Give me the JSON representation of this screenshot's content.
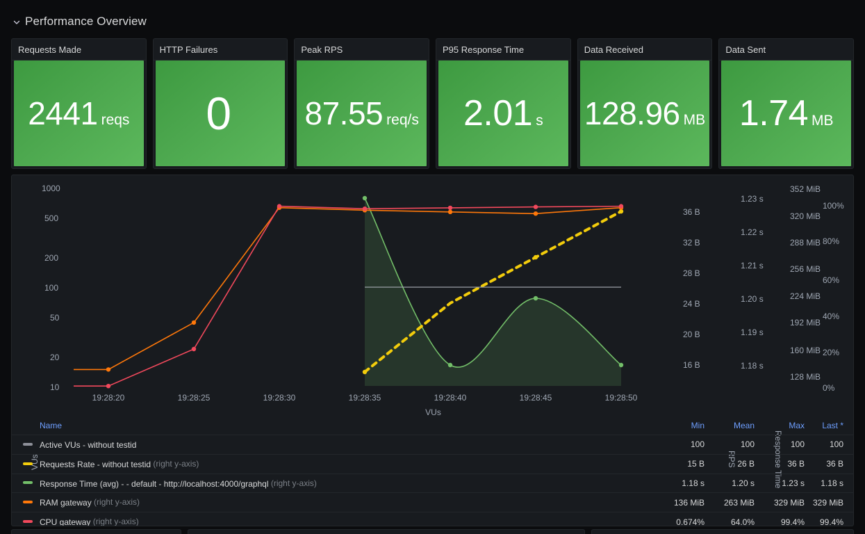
{
  "row": {
    "title": "Performance Overview",
    "collapse_icon": "chevron-down-icon",
    "expanded": true
  },
  "stats": [
    {
      "title": "Requests Made",
      "value": "2441",
      "unit": "reqs",
      "color": "#5cb85c",
      "size": "small"
    },
    {
      "title": "HTTP Failures",
      "value": "0",
      "unit": "",
      "color": "#5cb85c",
      "size": "big"
    },
    {
      "title": "Peak RPS",
      "value": "87.55",
      "unit": "req/s",
      "color": "#5cb85c",
      "size": "small"
    },
    {
      "title": "P95 Response Time",
      "value": "2.01",
      "unit": "s",
      "color": "#5cb85c",
      "size": "mid"
    },
    {
      "title": "Data Received",
      "value": "128.96",
      "unit": "MB",
      "color": "#5cb85c",
      "size": "small"
    },
    {
      "title": "Data Sent",
      "value": "1.74",
      "unit": "MB",
      "color": "#5cb85c",
      "size": "mid"
    }
  ],
  "chart_data": {
    "type": "line",
    "title": "",
    "xlabel": "VUs",
    "x_ticks": [
      "19:28:20",
      "19:28:25",
      "19:28:30",
      "19:28:35",
      "19:28:40",
      "19:28:45",
      "19:28:50"
    ],
    "grid": false,
    "legend_position": "bottom-table",
    "axes": [
      {
        "id": "left-vus",
        "side": "left",
        "title": "VUs",
        "scale": "log",
        "ticks": [
          "1000",
          "500",
          "200",
          "100",
          "50",
          "20",
          "10"
        ],
        "tick_values": [
          1000,
          500,
          200,
          100,
          50,
          20,
          10
        ]
      },
      {
        "id": "right-bytes",
        "side": "right",
        "title": "",
        "scale": "linear",
        "ticks": [
          "36 B",
          "32 B",
          "28 B",
          "24 B",
          "20 B",
          "16 B"
        ],
        "tick_values": [
          36,
          32,
          28,
          24,
          20,
          16
        ]
      },
      {
        "id": "right-rps",
        "side": "right",
        "title": "RPS",
        "scale": "linear",
        "ticks": [
          "1.23 s",
          "1.22 s",
          "1.21 s",
          "1.20 s",
          "1.19 s",
          "1.18 s"
        ],
        "tick_values": [
          1.23,
          1.22,
          1.21,
          1.2,
          1.19,
          1.18
        ]
      },
      {
        "id": "right-resptime",
        "side": "right",
        "title": "Response Time",
        "scale": "linear",
        "ticks": [
          "352 MiB",
          "320 MiB",
          "288 MiB",
          "256 MiB",
          "224 MiB",
          "192 MiB",
          "160 MiB",
          "128 MiB"
        ],
        "tick_values": [
          352,
          320,
          288,
          256,
          224,
          192,
          160,
          128
        ]
      },
      {
        "id": "right-percent",
        "side": "right",
        "title": "",
        "scale": "linear",
        "ticks": [
          "100%",
          "80%",
          "60%",
          "40%",
          "20%",
          "0%"
        ],
        "tick_values": [
          100,
          80,
          60,
          40,
          20,
          0
        ]
      }
    ],
    "series": [
      {
        "name": "Active VUs - without testid",
        "color": "#8e9099",
        "axis": "left-vus",
        "style": "line",
        "x": [
          "19:28:35",
          "19:28:50"
        ],
        "values": [
          100,
          100
        ]
      },
      {
        "name": "Requests Rate - without testid",
        "color": "#f2cc0c",
        "axis": "right-bytes",
        "style": "dashed",
        "x": [
          "19:28:35",
          "19:28:40",
          "19:28:45",
          "19:28:50"
        ],
        "values": [
          15,
          24,
          30,
          36
        ]
      },
      {
        "name": "Response Time (avg) - - default - http://localhost:4000/graphql",
        "color": "#73bf69",
        "axis": "right-rps",
        "style": "area",
        "x": [
          "19:28:35",
          "19:28:40",
          "19:28:45",
          "19:28:50"
        ],
        "values": [
          1.23,
          1.18,
          1.2,
          1.18
        ]
      },
      {
        "name": "RAM gateway",
        "color": "#ff780a",
        "axis": "right-resptime",
        "style": "line",
        "x": [
          "19:28:15",
          "19:28:20",
          "19:28:25",
          "19:28:30",
          "19:28:35",
          "19:28:40",
          "19:28:45",
          "19:28:50"
        ],
        "values": [
          136,
          136,
          192,
          329,
          326,
          324,
          322,
          329
        ]
      },
      {
        "name": "CPU gateway",
        "color": "#f2495c",
        "axis": "right-percent",
        "style": "line",
        "x": [
          "19:28:15",
          "19:28:20",
          "19:28:25",
          "19:28:30",
          "19:28:35",
          "19:28:40",
          "19:28:45",
          "19:28:50"
        ],
        "values": [
          0.674,
          0.674,
          21,
          99.4,
          98,
          98.5,
          99,
          99.4
        ]
      }
    ]
  },
  "legend": {
    "columns": [
      "Name",
      "Min",
      "Mean",
      "Max",
      "Last *"
    ],
    "rows": [
      {
        "color": "#8e9099",
        "name": "Active VUs - without testid",
        "axis_note": "",
        "min": "100",
        "mean": "100",
        "max": "100",
        "last": "100"
      },
      {
        "color": "#f2cc0c",
        "name": "Requests Rate - without testid",
        "axis_note": "(right y-axis)",
        "min": "15 B",
        "mean": "26 B",
        "max": "36 B",
        "last": "36 B"
      },
      {
        "color": "#73bf69",
        "name": "Response Time (avg) - - default - http://localhost:4000/graphql",
        "axis_note": "(right y-axis)",
        "min": "1.18 s",
        "mean": "1.20 s",
        "max": "1.23 s",
        "last": "1.18 s"
      },
      {
        "color": "#ff780a",
        "name": "RAM gateway",
        "axis_note": "(right y-axis)",
        "min": "136 MiB",
        "mean": "263 MiB",
        "max": "329 MiB",
        "last": "329 MiB"
      },
      {
        "color": "#f2495c",
        "name": "CPU gateway",
        "axis_note": "(right y-axis)",
        "min": "0.674%",
        "mean": "64.0%",
        "max": "99.4%",
        "last": "99.4%"
      }
    ]
  }
}
